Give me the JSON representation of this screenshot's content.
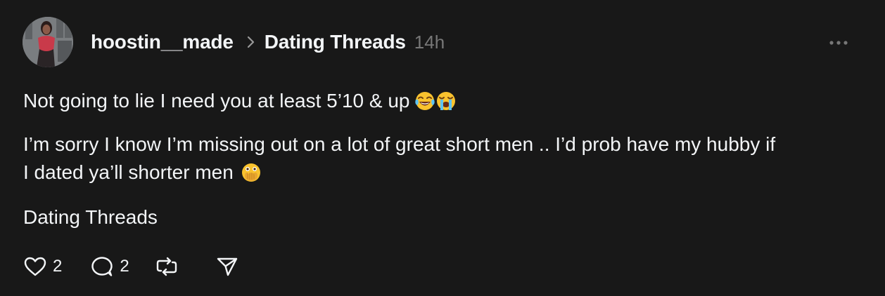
{
  "post": {
    "author": "hoostin__made",
    "community": "Dating Threads",
    "time": "14h",
    "paragraphs": [
      "Not going to lie I need you at least 5’10 & up",
      "I’m sorry I know I’m missing out on a lot of great short men .. I’d prob have my hubby if",
      "I dated ya’ll shorter men"
    ],
    "tag": "Dating Threads",
    "emojis": [
      "laughing-crying-emoji",
      "loudly-crying-emoji",
      "face-with-open-eyes-and-hand-over-mouth-emoji"
    ],
    "likes": "2",
    "replies": "2"
  },
  "icons": {
    "more": "more-horizontal-icon",
    "chevron": "chevron-right-icon",
    "like": "heart-icon",
    "reply": "comment-icon",
    "repost": "repost-icon",
    "share": "send-icon"
  },
  "colors": {
    "background": "#181818",
    "text": "#f3f5f7",
    "muted": "#777777"
  }
}
